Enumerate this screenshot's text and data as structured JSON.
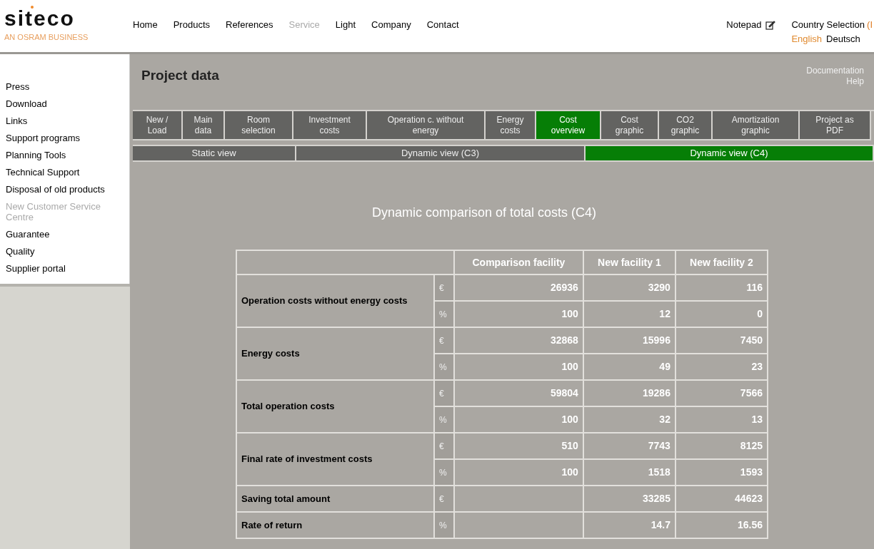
{
  "logo": {
    "name": "siteco",
    "tagline": "AN OSRAM BUSINESS"
  },
  "nav": [
    {
      "label": "Home",
      "selected": false
    },
    {
      "label": "Products",
      "selected": false
    },
    {
      "label": "References",
      "selected": false
    },
    {
      "label": "Service",
      "selected": true
    },
    {
      "label": "Light",
      "selected": false
    },
    {
      "label": "Company",
      "selected": false
    },
    {
      "label": "Contact",
      "selected": false
    }
  ],
  "notepad": "Notepad",
  "country": {
    "label": "Country Selection",
    "extra": "(I"
  },
  "languages": [
    {
      "label": "English",
      "selected": true
    },
    {
      "label": "Deutsch",
      "selected": false
    }
  ],
  "sidebar": {
    "items": [
      {
        "label": "Press",
        "selected": false
      },
      {
        "label": "Download",
        "selected": false
      },
      {
        "label": "Links",
        "selected": false
      },
      {
        "label": "Support programs",
        "selected": false
      },
      {
        "label": "Planning Tools",
        "selected": false
      },
      {
        "label": "Technical Support",
        "selected": false
      },
      {
        "label": "Disposal of old products",
        "selected": false
      },
      {
        "label": "New Customer Service Centre",
        "selected": true
      },
      {
        "label": "Guarantee",
        "selected": false
      },
      {
        "label": "Quality",
        "selected": false
      },
      {
        "label": "Supplier portal",
        "selected": false
      }
    ]
  },
  "page_title": "Project data",
  "top_links": [
    "Documentation",
    "Help"
  ],
  "tabs": [
    {
      "label": "New / Load",
      "selected": false
    },
    {
      "label": "Main data",
      "selected": false
    },
    {
      "label": "Room selection",
      "selected": false
    },
    {
      "label": "Investment costs",
      "selected": false
    },
    {
      "label": "Operation c. without energy",
      "selected": false
    },
    {
      "label": "Energy costs",
      "selected": false
    },
    {
      "label": "Cost overview",
      "selected": true
    },
    {
      "label": "Cost graphic",
      "selected": false
    },
    {
      "label": "CO2 graphic",
      "selected": false
    },
    {
      "label": "Amortization graphic",
      "selected": false
    },
    {
      "label": "Project as PDF",
      "selected": false
    }
  ],
  "subtabs": [
    {
      "label": "Static view",
      "selected": false
    },
    {
      "label": "Dynamic view (C3)",
      "selected": false
    },
    {
      "label": "Dynamic view (C4)",
      "selected": true
    }
  ],
  "heading": "Dynamic comparison of total costs (C4)",
  "table": {
    "columns": [
      "Comparison facility",
      "New facility 1",
      "New facility 2"
    ],
    "groups": [
      {
        "label": "Operation costs without energy costs",
        "rows": [
          {
            "kind": "full",
            "unit": "€",
            "values": [
              "26936",
              "3290",
              "116"
            ]
          },
          {
            "kind": "full",
            "unit": "%",
            "values": [
              "100",
              "12",
              "0"
            ]
          }
        ]
      },
      {
        "label": "Energy costs",
        "rows": [
          {
            "kind": "full",
            "unit": "€",
            "values": [
              "32868",
              "15996",
              "7450"
            ]
          },
          {
            "kind": "full",
            "unit": "%",
            "values": [
              "100",
              "49",
              "23"
            ]
          }
        ]
      },
      {
        "label": "Total operation costs",
        "rows": [
          {
            "kind": "full",
            "unit": "€",
            "values": [
              "59804",
              "19286",
              "7566"
            ]
          },
          {
            "kind": "full",
            "unit": "%",
            "values": [
              "100",
              "32",
              "13"
            ]
          }
        ]
      },
      {
        "label": "Final rate of investment costs",
        "rows": [
          {
            "kind": "full",
            "unit": "€",
            "values": [
              "510",
              "7743",
              "8125"
            ]
          },
          {
            "kind": "full",
            "unit": "%",
            "values": [
              "100",
              "1518",
              "1593"
            ]
          }
        ]
      },
      {
        "label": "Saving total amount",
        "rows": [
          {
            "kind": "new_only",
            "unit": "€",
            "values": [
              "33285",
              "44623"
            ]
          }
        ]
      },
      {
        "label": "Rate of return",
        "rows": [
          {
            "kind": "new_only",
            "unit": "%",
            "values": [
              "14.7",
              "16.56"
            ]
          }
        ]
      }
    ]
  }
}
